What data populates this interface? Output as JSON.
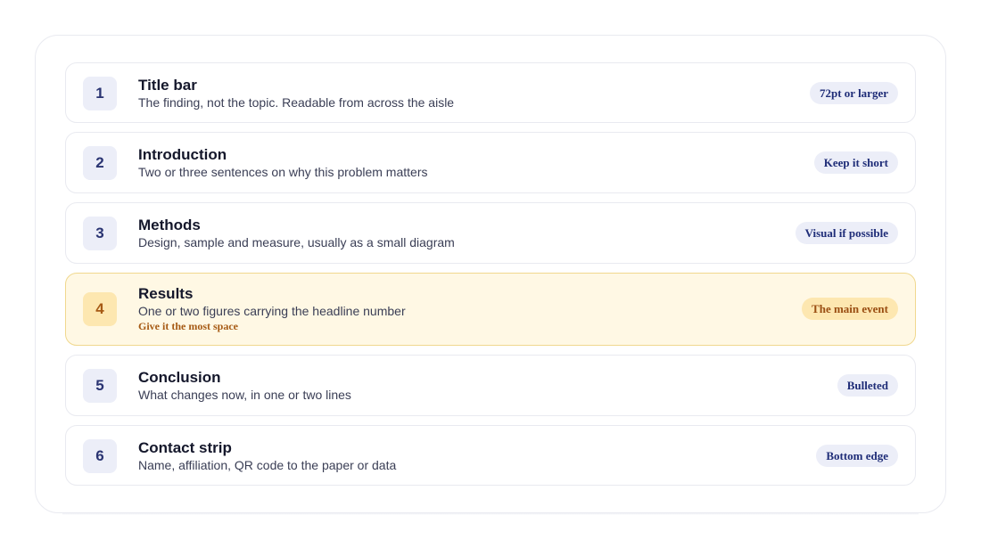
{
  "steps": [
    {
      "number": "1",
      "title": "Title bar",
      "description": "The finding, not the topic. Readable from across the aisle",
      "badge": "72pt or larger"
    },
    {
      "number": "2",
      "title": "Introduction",
      "description": "Two or three sentences on why this problem matters",
      "badge": "Keep it short"
    },
    {
      "number": "3",
      "title": "Methods",
      "description": "Design, sample and measure, usually as a small diagram",
      "badge": "Visual if possible"
    },
    {
      "number": "4",
      "title": "Results",
      "description": "One or two figures carrying the headline number",
      "note": "Give it the most space",
      "badge": "The main event",
      "highlighted": true
    },
    {
      "number": "5",
      "title": "Conclusion",
      "description": "What changes now, in one or two lines",
      "badge": "Bulleted"
    },
    {
      "number": "6",
      "title": "Contact strip",
      "description": "Name, affiliation, QR code to the paper or data",
      "badge": "Bottom edge"
    }
  ],
  "colors": {
    "accent": "#2a3472",
    "highlight_background": "#fff8e4",
    "highlight_accent": "#a65a14"
  }
}
